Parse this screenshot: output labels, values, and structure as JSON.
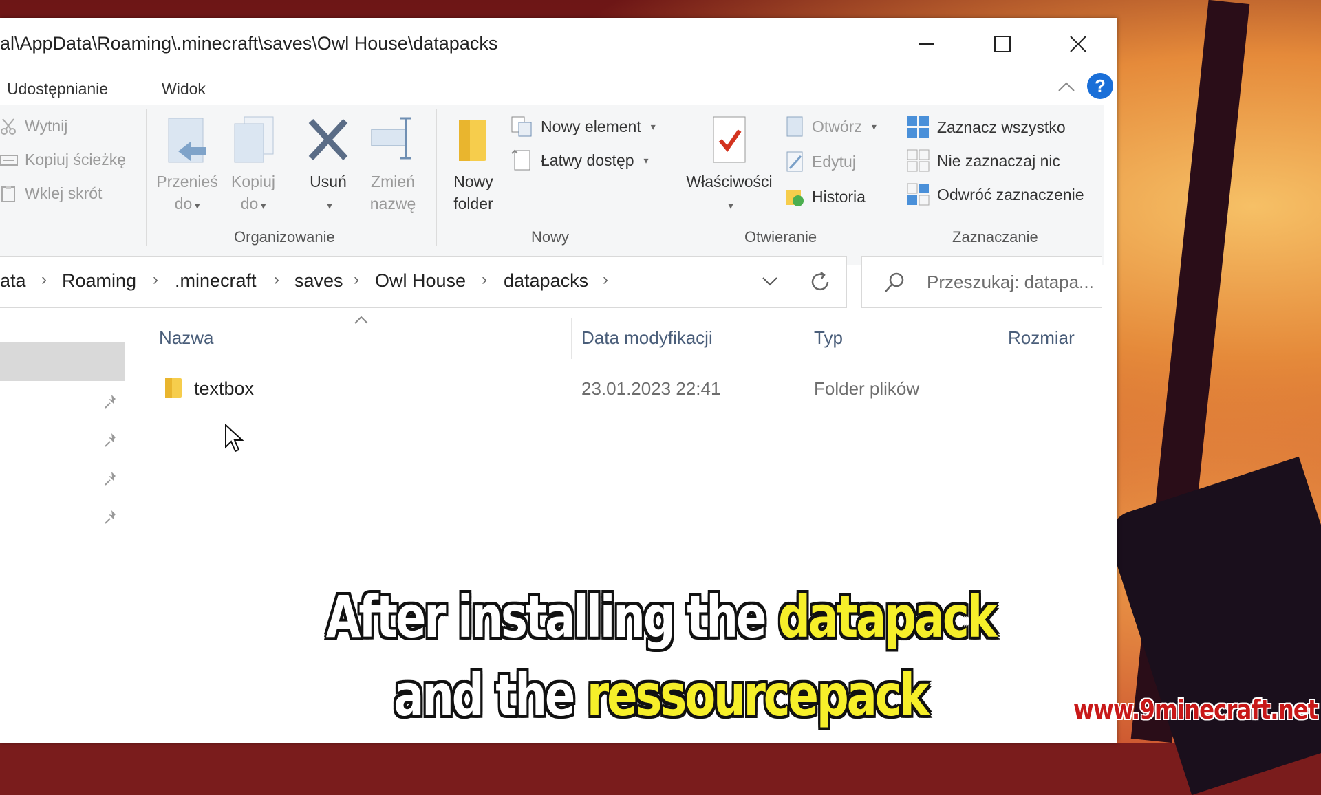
{
  "window": {
    "title": "al\\AppData\\Roaming\\.minecraft\\saves\\Owl House\\datapacks"
  },
  "menu": {
    "tabs": [
      "Udostępnianie",
      "Widok"
    ]
  },
  "ribbon": {
    "clipboard": {
      "cut": "Wytnij",
      "copy_path": "Kopiuj ścieżkę",
      "paste_shortcut": "Wklej skrót"
    },
    "organize": {
      "label": "Organizowanie",
      "move_to": [
        "Przenieś",
        "do"
      ],
      "copy_to": [
        "Kopiuj",
        "do"
      ],
      "delete": "Usuń",
      "rename": [
        "Zmień",
        "nazwę"
      ]
    },
    "new": {
      "label": "Nowy",
      "new_folder": [
        "Nowy",
        "folder"
      ],
      "new_item": "Nowy element",
      "easy_access": "Łatwy dostęp"
    },
    "open": {
      "label": "Otwieranie",
      "properties": "Właściwości",
      "open": "Otwórz",
      "edit": "Edytuj",
      "history": "Historia"
    },
    "select": {
      "label": "Zaznaczanie",
      "select_all": "Zaznacz wszystko",
      "select_none": "Nie zaznaczaj nic",
      "invert": "Odwróć zaznaczenie"
    }
  },
  "address": {
    "crumbs": [
      "ata",
      "Roaming",
      ".minecraft",
      "saves",
      "Owl House",
      "datapacks"
    ]
  },
  "search": {
    "placeholder": "Przeszukaj: datapa..."
  },
  "columns": {
    "name": "Nazwa",
    "modified": "Data modyfikacji",
    "type": "Typ",
    "size": "Rozmiar"
  },
  "files": [
    {
      "name": "textbox",
      "modified": "23.01.2023 22:41",
      "type": "Folder plików",
      "size": ""
    }
  ],
  "caption": {
    "line1_a": "After installing the ",
    "line1_b": "datapack",
    "line2_a": "and the ",
    "line2_b": "ressourcepack"
  },
  "watermark": "www.9minecraft.net",
  "colors": {
    "accent": "#1a6fd8",
    "caption_highlight": "#f6ef2a",
    "watermark": "#c81818"
  }
}
